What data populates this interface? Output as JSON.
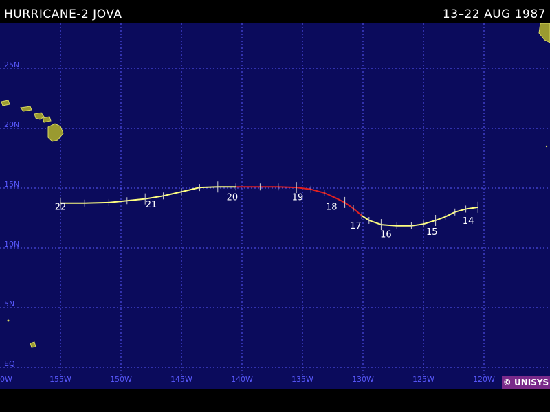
{
  "header": {
    "title": "HURRICANE-2 JOVA",
    "dates": "13–22 AUG 1987"
  },
  "colors": {
    "background": "#0b0b5c",
    "grid": "#5a5aff",
    "land": "#9a9a30",
    "hurricane": "#e02020",
    "storm": "#ffff80"
  },
  "latitude_labels": [
    "25N",
    "20N",
    "15N",
    "10N",
    "5N",
    "EQ"
  ],
  "longitude_labels": [
    "0W",
    "155W",
    "150W",
    "145W",
    "140W",
    "135W",
    "130W",
    "125W",
    "120W"
  ],
  "day_labels": [
    {
      "day": "22",
      "lon": -155.0,
      "lat": 13.2
    },
    {
      "day": "21",
      "lon": -147.5,
      "lat": 13.4
    },
    {
      "day": "20",
      "lon": -140.8,
      "lat": 14.0
    },
    {
      "day": "19",
      "lon": -135.4,
      "lat": 14.0
    },
    {
      "day": "18",
      "lon": -132.6,
      "lat": 13.2
    },
    {
      "day": "17",
      "lon": -130.6,
      "lat": 11.6
    },
    {
      "day": "16",
      "lon": -128.1,
      "lat": 10.9
    },
    {
      "day": "15",
      "lon": -124.3,
      "lat": 11.1
    },
    {
      "day": "14",
      "lon": -121.3,
      "lat": 12.0
    }
  ],
  "track": [
    {
      "lon": -120.5,
      "lat": 13.4,
      "stage": "storm"
    },
    {
      "lon": -121.5,
      "lat": 13.25,
      "stage": "storm"
    },
    {
      "lon": -122.4,
      "lat": 13.0,
      "stage": "storm"
    },
    {
      "lon": -123.2,
      "lat": 12.6,
      "stage": "storm"
    },
    {
      "lon": -124.0,
      "lat": 12.3,
      "stage": "storm"
    },
    {
      "lon": -125.0,
      "lat": 12.0,
      "stage": "storm"
    },
    {
      "lon": -126.0,
      "lat": 11.85,
      "stage": "storm"
    },
    {
      "lon": -127.2,
      "lat": 11.85,
      "stage": "storm"
    },
    {
      "lon": -128.5,
      "lat": 11.95,
      "stage": "storm"
    },
    {
      "lon": -129.5,
      "lat": 12.3,
      "stage": "storm"
    },
    {
      "lon": -130.1,
      "lat": 12.7,
      "stage": "hurricane"
    },
    {
      "lon": -130.8,
      "lat": 13.3,
      "stage": "hurricane"
    },
    {
      "lon": -131.5,
      "lat": 13.8,
      "stage": "hurricane"
    },
    {
      "lon": -132.3,
      "lat": 14.2,
      "stage": "hurricane"
    },
    {
      "lon": -133.2,
      "lat": 14.6,
      "stage": "hurricane"
    },
    {
      "lon": -134.3,
      "lat": 14.9,
      "stage": "hurricane"
    },
    {
      "lon": -135.5,
      "lat": 15.05,
      "stage": "hurricane"
    },
    {
      "lon": -137.0,
      "lat": 15.1,
      "stage": "hurricane"
    },
    {
      "lon": -138.5,
      "lat": 15.1,
      "stage": "hurricane"
    },
    {
      "lon": -140.5,
      "lat": 15.1,
      "stage": "storm"
    },
    {
      "lon": -142.0,
      "lat": 15.1,
      "stage": "storm"
    },
    {
      "lon": -143.5,
      "lat": 15.05,
      "stage": "storm"
    },
    {
      "lon": -145.0,
      "lat": 14.7,
      "stage": "storm"
    },
    {
      "lon": -146.5,
      "lat": 14.35,
      "stage": "storm"
    },
    {
      "lon": -148.0,
      "lat": 14.1,
      "stage": "storm"
    },
    {
      "lon": -149.5,
      "lat": 13.95,
      "stage": "storm"
    },
    {
      "lon": -151.0,
      "lat": 13.8,
      "stage": "storm"
    },
    {
      "lon": -153.0,
      "lat": 13.75,
      "stage": "storm"
    },
    {
      "lon": -155.0,
      "lat": 13.75,
      "stage": "storm"
    }
  ],
  "logo_text": "© UNISYS"
}
